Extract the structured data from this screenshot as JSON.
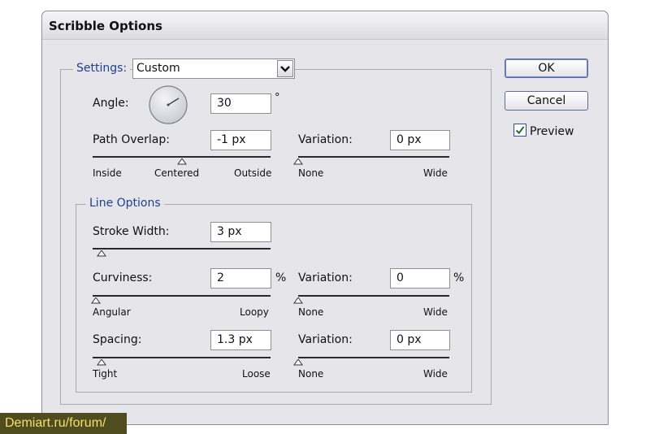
{
  "window": {
    "title": "Scribble Options"
  },
  "settings": {
    "label": "Settings:",
    "preset_value": "Custom",
    "angle_label": "Angle:",
    "angle_value": "30",
    "angle_unit": "°",
    "path_overlap_label": "Path Overlap:",
    "path_overlap_value": "-1 px",
    "path_overlap_slider": {
      "min_label": "Inside",
      "mid_label": "Centered",
      "max_label": "Outside",
      "level": 0.5
    },
    "variation_label": "Variation:",
    "variation_value": "0 px",
    "variation_slider": {
      "min_label": "None",
      "max_label": "Wide",
      "level": 0.0
    }
  },
  "line_options": {
    "legend": "Line Options",
    "stroke_width_label": "Stroke Width:",
    "stroke_width_value": "3 px",
    "stroke_width_slider": {
      "level": 0.05
    },
    "curviness_label": "Curviness:",
    "curviness_value": "2",
    "curviness_unit": "%",
    "curviness_slider": {
      "min_label": "Angular",
      "max_label": "Loopy",
      "level": 0.02
    },
    "curviness_variation_label": "Variation:",
    "curviness_variation_value": "0",
    "curviness_variation_unit": "%",
    "curviness_variation_slider": {
      "min_label": "None",
      "max_label": "Wide",
      "level": 0.0
    },
    "spacing_label": "Spacing:",
    "spacing_value": "1.3 px",
    "spacing_slider": {
      "min_label": "Tight",
      "max_label": "Loose",
      "level": 0.05
    },
    "spacing_variation_label": "Variation:",
    "spacing_variation_value": "0 px",
    "spacing_variation_slider": {
      "min_label": "None",
      "max_label": "Wide",
      "level": 0.0
    }
  },
  "buttons": {
    "ok": "OK",
    "cancel": "Cancel"
  },
  "preview": {
    "label": "Preview",
    "checked": true
  },
  "watermark": "Demiart.ru/forum/"
}
